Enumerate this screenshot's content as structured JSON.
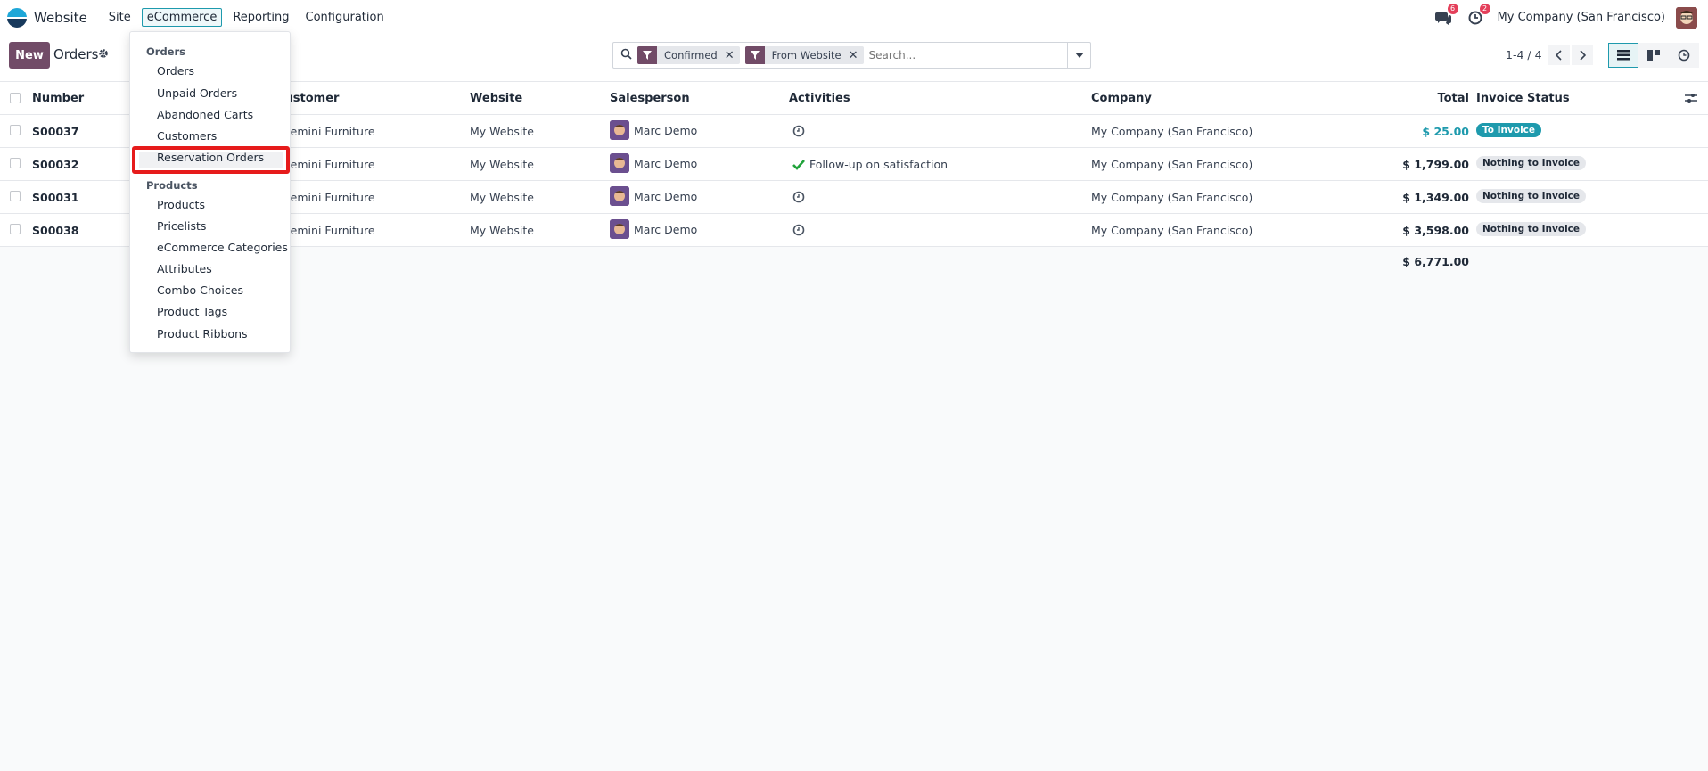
{
  "navbar": {
    "app_name": "Website",
    "menu": [
      "Site",
      "eCommerce",
      "Reporting",
      "Configuration"
    ],
    "messages_badge": "6",
    "activities_badge": "2",
    "company": "My Company (San Francisco)"
  },
  "control_panel": {
    "new_label": "New",
    "title": "Orders",
    "facets": [
      "Confirmed",
      "From Website"
    ],
    "search_placeholder": "Search...",
    "pager": "1-4 / 4"
  },
  "table": {
    "headers": [
      "Number",
      "Customer",
      "Website",
      "Salesperson",
      "Activities",
      "Company",
      "Total",
      "Invoice Status"
    ],
    "rows": [
      {
        "number": "S00037",
        "customer": "Gemini Furniture",
        "website": "My Website",
        "salesperson": "Marc Demo",
        "activity": "",
        "company": "My Company (San Francisco)",
        "total": "$ 25.00",
        "status": "To Invoice"
      },
      {
        "number": "S00032",
        "customer": "Gemini Furniture",
        "website": "My Website",
        "salesperson": "Marc Demo",
        "activity": "Follow-up on satisfaction",
        "company": "My Company (San Francisco)",
        "total": "$ 1,799.00",
        "status": "Nothing to Invoice"
      },
      {
        "number": "S00031",
        "customer": "Gemini Furniture",
        "website": "My Website",
        "salesperson": "Marc Demo",
        "activity": "",
        "company": "My Company (San Francisco)",
        "total": "$ 1,349.00",
        "status": "Nothing to Invoice"
      },
      {
        "number": "S00038",
        "customer": "Gemini Furniture",
        "website": "My Website",
        "salesperson": "Marc Demo",
        "activity": "",
        "company": "My Company (San Francisco)",
        "total": "$ 3,598.00",
        "status": "Nothing to Invoice"
      }
    ],
    "grand_total": "$ 6,771.00"
  },
  "dropdown": {
    "orders_header": "Orders",
    "orders_items": [
      "Orders",
      "Unpaid Orders",
      "Abandoned Carts",
      "Customers",
      "Reservation Orders"
    ],
    "products_header": "Products",
    "products_items": [
      "Products",
      "Pricelists",
      "eCommerce Categories",
      "Attributes",
      "Combo Choices",
      "Product Tags",
      "Product Ribbons"
    ]
  },
  "colors": {
    "primary": "#714b67",
    "accent": "#1e9aad",
    "highlight_border": "#e61b1b"
  }
}
